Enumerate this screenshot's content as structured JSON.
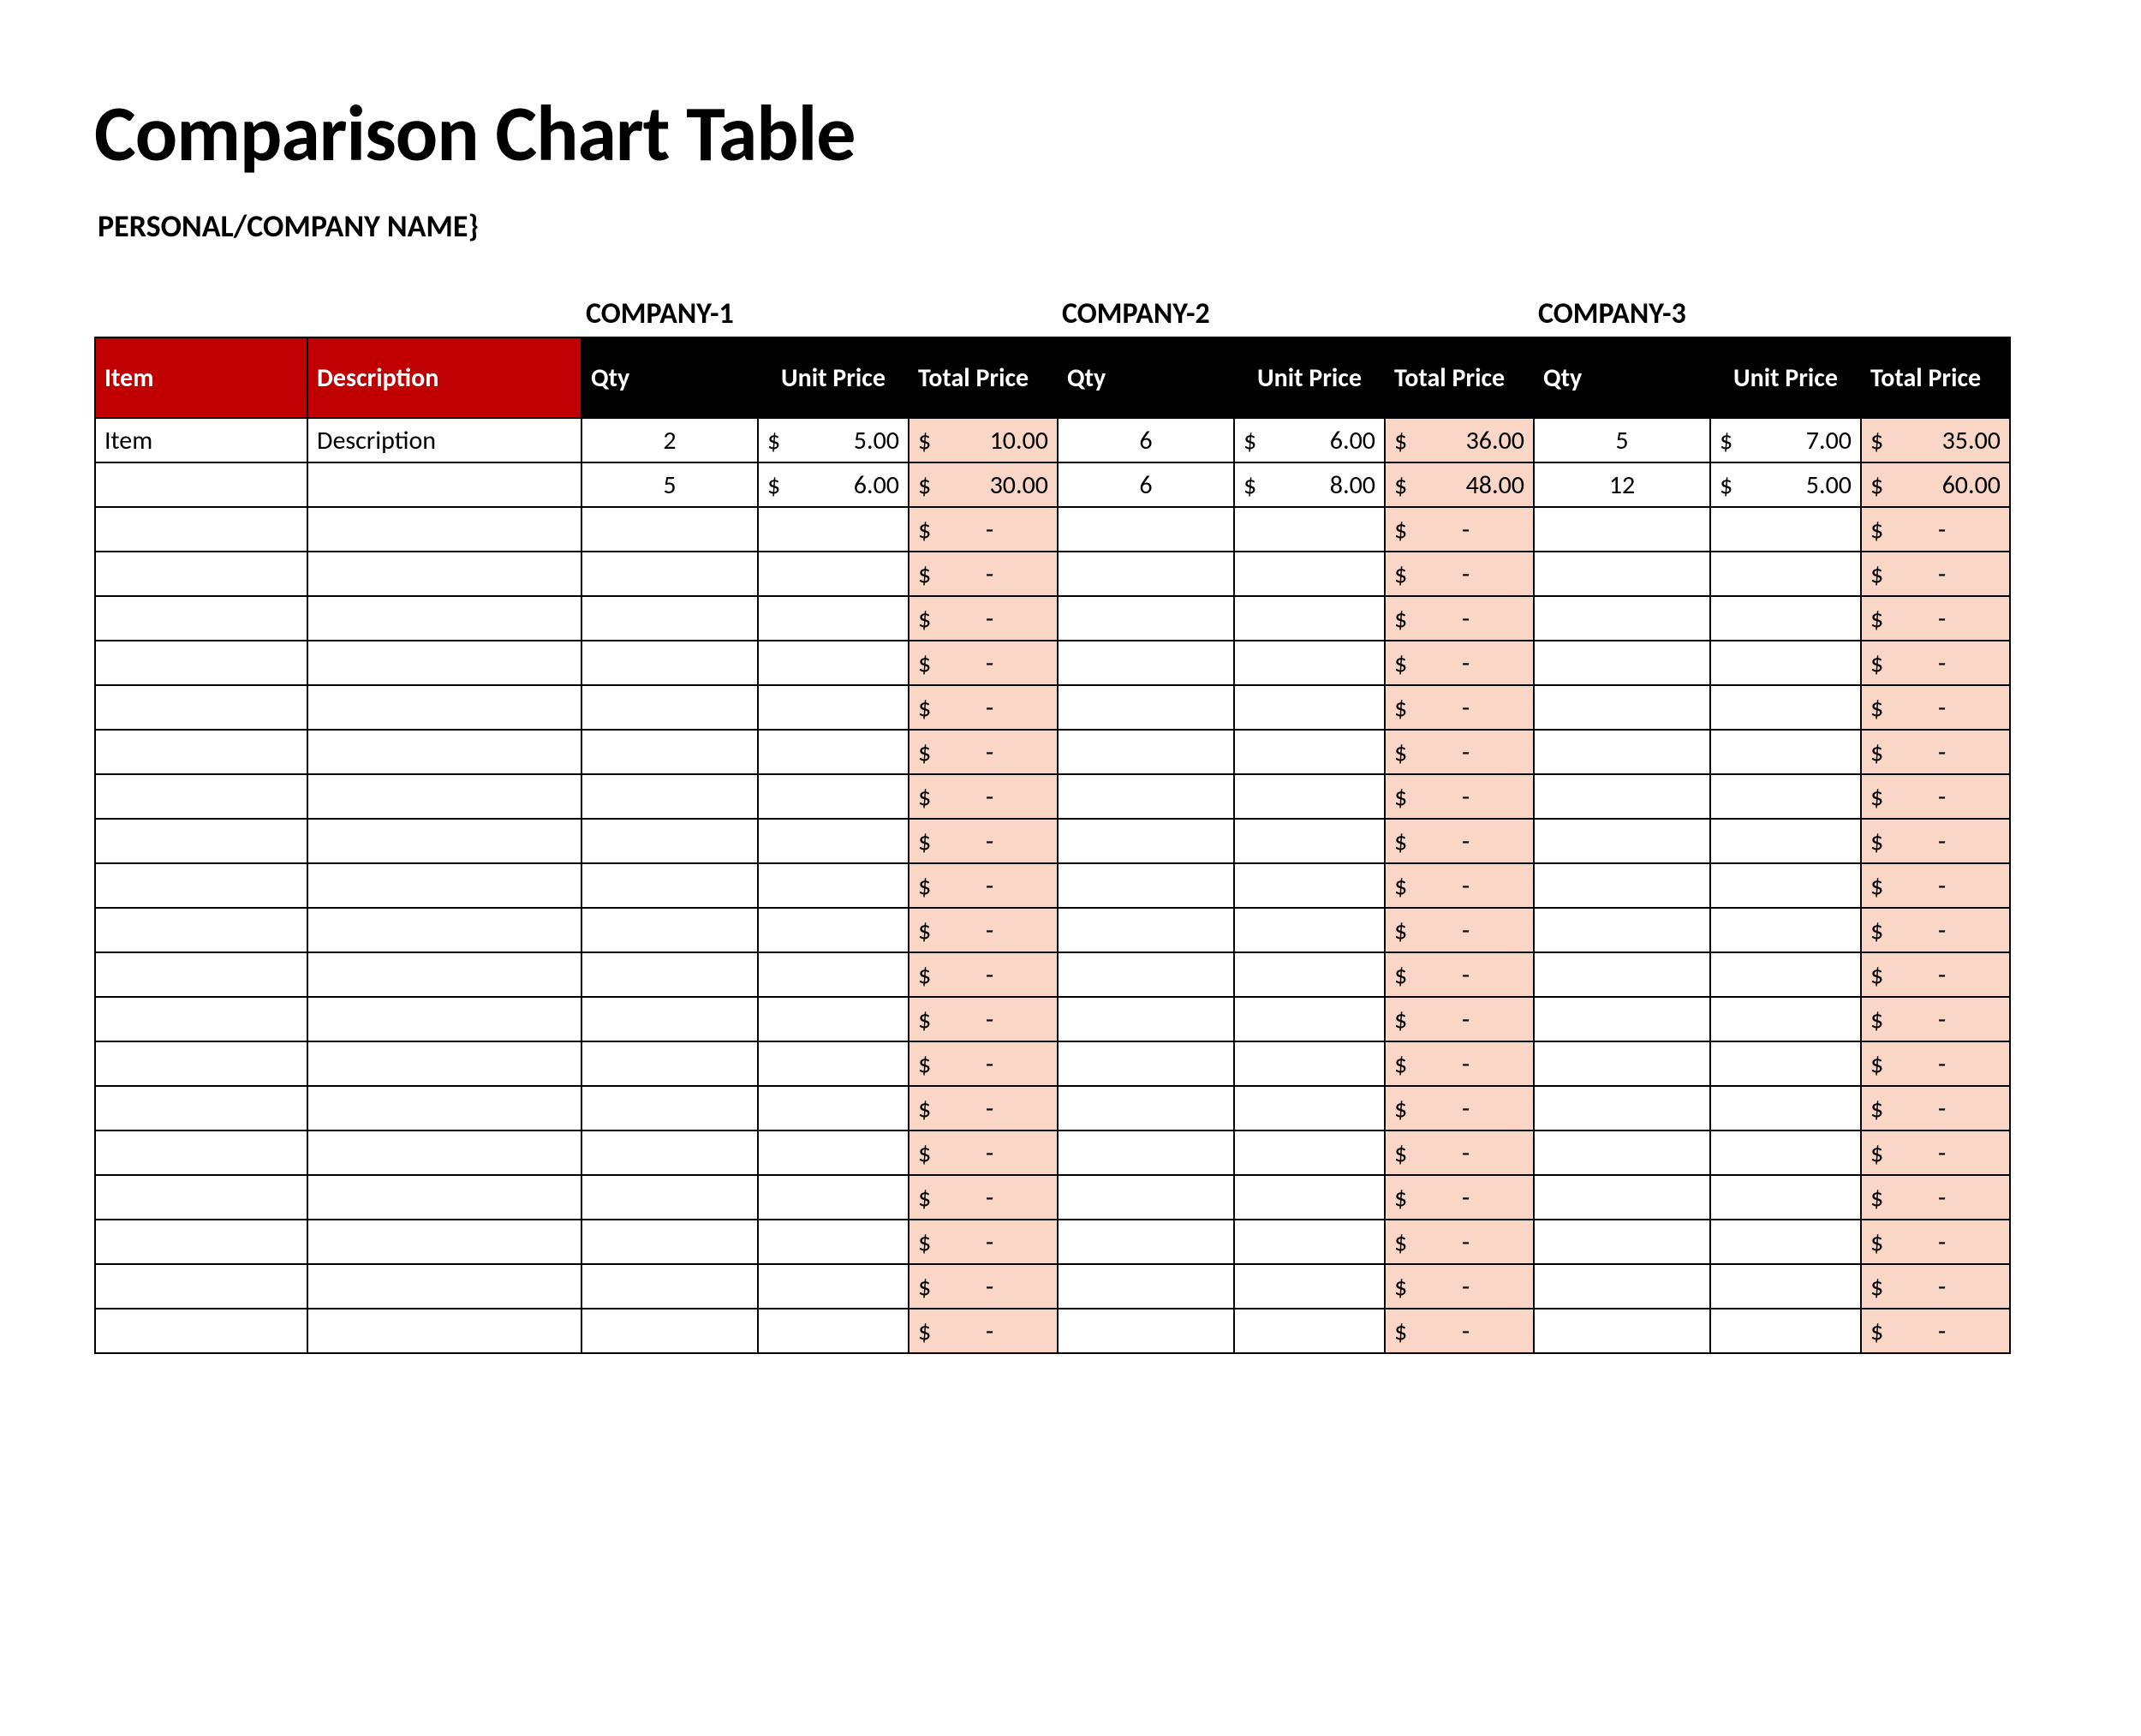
{
  "title": "Comparison Chart Table",
  "subtitle": "PERSONAL/COMPANY NAME}",
  "companies": [
    "COMPANY-1",
    "COMPANY-2",
    "COMPANY-3"
  ],
  "headers": {
    "item": "Item",
    "description": "Description",
    "qty": "Qty",
    "unit_price": "Unit Price",
    "total_price": "Total Price"
  },
  "currency_symbol": "$",
  "dash": "-",
  "rows": [
    {
      "item": "Item",
      "description": "Description",
      "c1": {
        "qty": "2",
        "unit": "5.00",
        "total": "10.00"
      },
      "c2": {
        "qty": "6",
        "unit": "6.00",
        "total": "36.00"
      },
      "c3": {
        "qty": "5",
        "unit": "7.00",
        "total": "35.00"
      }
    },
    {
      "item": "",
      "description": "",
      "c1": {
        "qty": "5",
        "unit": "6.00",
        "total": "30.00"
      },
      "c2": {
        "qty": "6",
        "unit": "8.00",
        "total": "48.00"
      },
      "c3": {
        "qty": "12",
        "unit": "5.00",
        "total": "60.00"
      }
    }
  ],
  "empty_row_count": 19,
  "chart_data": {
    "type": "table",
    "title": "Comparison Chart Table",
    "columns_per_company": [
      "Qty",
      "Unit Price",
      "Total Price"
    ],
    "companies": [
      "COMPANY-1",
      "COMPANY-2",
      "COMPANY-3"
    ],
    "data": [
      {
        "item": "Item",
        "description": "Description",
        "COMPANY-1": {
          "qty": 2,
          "unit_price": 5.0,
          "total_price": 10.0
        },
        "COMPANY-2": {
          "qty": 6,
          "unit_price": 6.0,
          "total_price": 36.0
        },
        "COMPANY-3": {
          "qty": 5,
          "unit_price": 7.0,
          "total_price": 35.0
        }
      },
      {
        "item": "",
        "description": "",
        "COMPANY-1": {
          "qty": 5,
          "unit_price": 6.0,
          "total_price": 30.0
        },
        "COMPANY-2": {
          "qty": 6,
          "unit_price": 8.0,
          "total_price": 48.0
        },
        "COMPANY-3": {
          "qty": 12,
          "unit_price": 5.0,
          "total_price": 60.0
        }
      }
    ]
  }
}
